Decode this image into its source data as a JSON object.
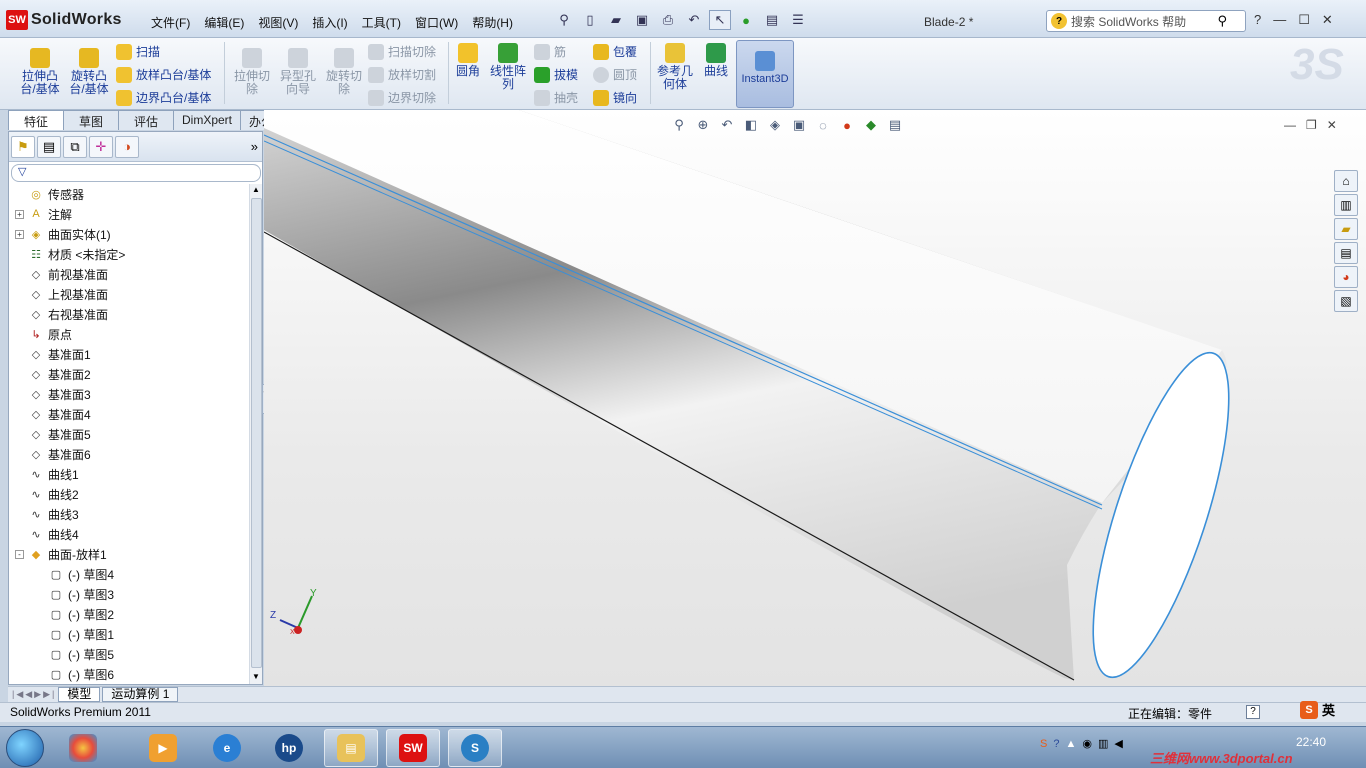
{
  "app": {
    "name": "SolidWorks",
    "document_title": "Blade-2 *",
    "search_placeholder": "搜索 SolidWorks 帮助"
  },
  "menu": [
    "文件(F)",
    "编辑(E)",
    "视图(V)",
    "插入(I)",
    "工具(T)",
    "窗口(W)",
    "帮助(H)"
  ],
  "ribbon": {
    "extrude_boss": "拉伸凸\n台/基体",
    "revolve_boss": "旋转凸\n台/基体",
    "sweep": "扫描",
    "loft_boss": "放样凸台/基体",
    "boundary_boss": "边界凸台/基体",
    "extrude_cut": "拉伸切\n除",
    "hole_wizard": "异型孔\n向导",
    "revolve_cut": "旋转切\n除",
    "swept_cut": "扫描切除",
    "lofted_cut": "放样切割",
    "boundary_cut": "边界切除",
    "fillet": "圆角",
    "linear_pattern": "线性阵\n列",
    "rib": "筋",
    "draft": "拔模",
    "shell": "抽壳",
    "wrap": "包覆",
    "dome": "圆顶",
    "mirror": "镜向",
    "ref_geometry": "参考几\n何体",
    "curves": "曲线",
    "instant3d": "Instant3D"
  },
  "command_tabs": [
    "特征",
    "草图",
    "评估",
    "DimXpert",
    "办公室产品"
  ],
  "tree": [
    {
      "label": "传感器",
      "icon": "sensor-icon",
      "level": 0,
      "expand": ""
    },
    {
      "label": "注解",
      "icon": "annotation-icon",
      "level": 0,
      "expand": "+"
    },
    {
      "label": "曲面实体(1)",
      "icon": "surface-bodies-icon",
      "level": 0,
      "expand": "+"
    },
    {
      "label": "材质 <未指定>",
      "icon": "material-icon",
      "level": 0,
      "expand": ""
    },
    {
      "label": "前视基准面",
      "icon": "plane-icon",
      "level": 0,
      "expand": ""
    },
    {
      "label": "上视基准面",
      "icon": "plane-icon",
      "level": 0,
      "expand": ""
    },
    {
      "label": "右视基准面",
      "icon": "plane-icon",
      "level": 0,
      "expand": ""
    },
    {
      "label": "原点",
      "icon": "origin-icon",
      "level": 0,
      "expand": ""
    },
    {
      "label": "基准面1",
      "icon": "plane-icon",
      "level": 0,
      "expand": ""
    },
    {
      "label": "基准面2",
      "icon": "plane-icon",
      "level": 0,
      "expand": ""
    },
    {
      "label": "基准面3",
      "icon": "plane-icon",
      "level": 0,
      "expand": ""
    },
    {
      "label": "基准面4",
      "icon": "plane-icon",
      "level": 0,
      "expand": ""
    },
    {
      "label": "基准面5",
      "icon": "plane-icon",
      "level": 0,
      "expand": ""
    },
    {
      "label": "基准面6",
      "icon": "plane-icon",
      "level": 0,
      "expand": ""
    },
    {
      "label": "曲线1",
      "icon": "curve-icon",
      "level": 0,
      "expand": ""
    },
    {
      "label": "曲线2",
      "icon": "curve-icon",
      "level": 0,
      "expand": ""
    },
    {
      "label": "曲线3",
      "icon": "curve-icon",
      "level": 0,
      "expand": ""
    },
    {
      "label": "曲线4",
      "icon": "curve-icon",
      "level": 0,
      "expand": ""
    },
    {
      "label": "曲面-放样1",
      "icon": "loft-surface-icon",
      "level": 0,
      "expand": "-"
    },
    {
      "label": "(-) 草图4",
      "icon": "sketch-icon",
      "level": 1,
      "expand": ""
    },
    {
      "label": "(-) 草图3",
      "icon": "sketch-icon",
      "level": 1,
      "expand": ""
    },
    {
      "label": "(-) 草图2",
      "icon": "sketch-icon",
      "level": 1,
      "expand": ""
    },
    {
      "label": "(-) 草图1",
      "icon": "sketch-icon",
      "level": 1,
      "expand": ""
    },
    {
      "label": "(-) 草图5",
      "icon": "sketch-icon",
      "level": 1,
      "expand": ""
    },
    {
      "label": "(-) 草图6",
      "icon": "sketch-icon",
      "level": 1,
      "expand": ""
    }
  ],
  "bottom_tabs": [
    "模型",
    "运动算例 1"
  ],
  "status": {
    "left": "SolidWorks Premium 2011",
    "right": "正在编辑：零件"
  },
  "ime_label": "英",
  "clock": "22:40",
  "watermark": "三维网www.3dportal.cn",
  "triad": {
    "x": "X",
    "y": "Y",
    "z": "Z"
  },
  "colors": {
    "accent": "#1c3d99",
    "edge_highlight": "#3a8fd8",
    "brand_red": "#d11111"
  }
}
